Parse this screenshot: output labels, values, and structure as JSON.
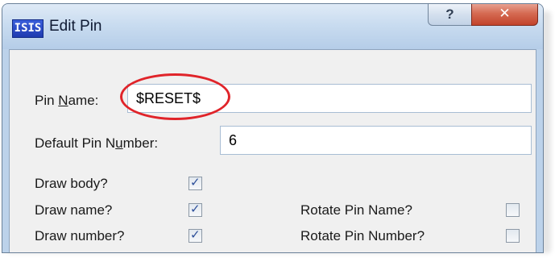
{
  "window": {
    "app_icon_text": "ISIS",
    "title": "Edit Pin",
    "help_label": "?",
    "close_label": "✕"
  },
  "pin_name": {
    "label_before": "Pin ",
    "label_accel": "N",
    "label_after": "ame:",
    "value": "$RESET$"
  },
  "pin_number": {
    "label_before": "Default Pin N",
    "label_accel": "u",
    "label_after": "mber:",
    "value": "6"
  },
  "options": {
    "draw_body": {
      "label": "Draw body?",
      "checked": true
    },
    "draw_name": {
      "label": "Draw name?",
      "checked": true
    },
    "draw_number": {
      "label": "Draw number?",
      "checked": true
    },
    "rotate_pin_name": {
      "label": "Rotate Pin Name?",
      "checked": false
    },
    "rotate_pin_number": {
      "label": "Rotate Pin Number?",
      "checked": false
    },
    "check_glyph": "✓"
  },
  "colors": {
    "highlight": "#e0242a",
    "close_button": "#c2432b",
    "check_mark": "#2d4f9a"
  }
}
